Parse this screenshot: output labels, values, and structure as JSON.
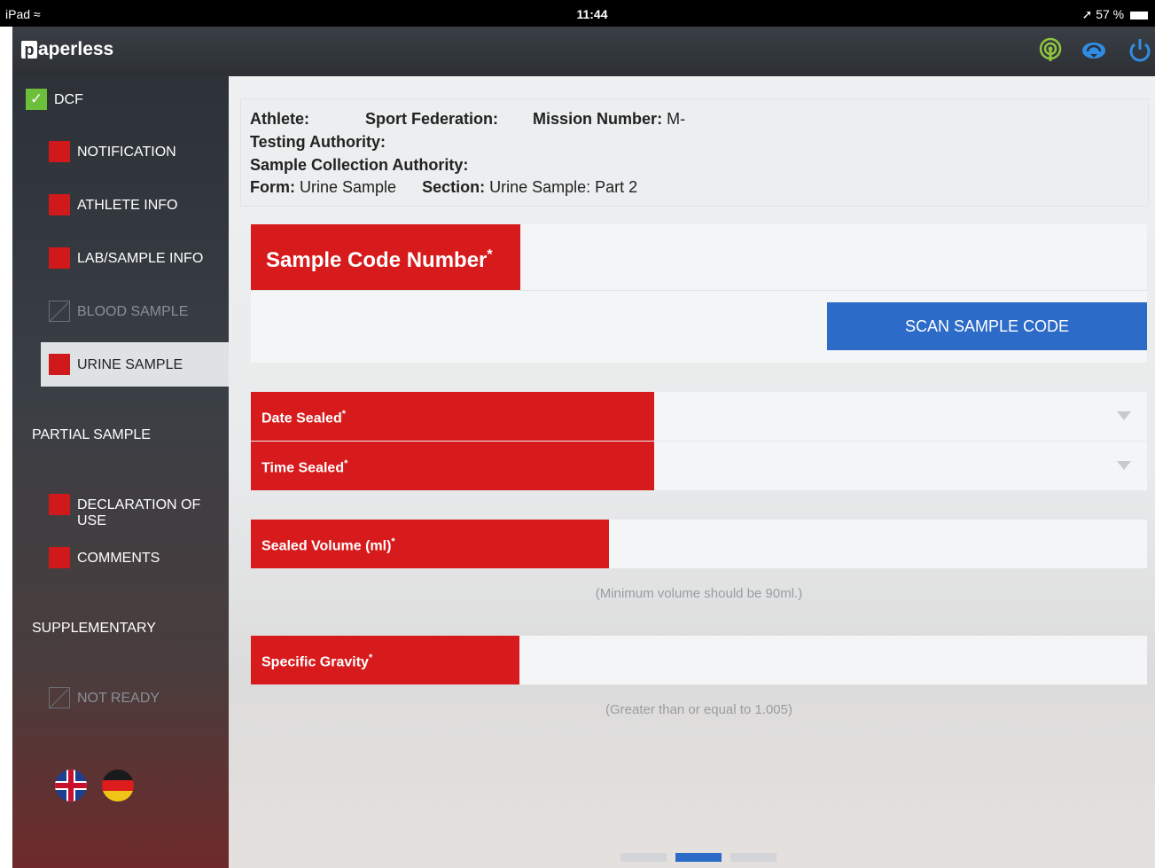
{
  "status_bar": {
    "device": "iPad",
    "time": "11:44",
    "battery": "57 %"
  },
  "app": {
    "logo": "paperless"
  },
  "sidebar": {
    "dcf_label": "DCF",
    "items": [
      {
        "label": "NOTIFICATION",
        "state": "incomplete"
      },
      {
        "label": "ATHLETE INFO",
        "state": "incomplete"
      },
      {
        "label": "LAB/SAMPLE INFO",
        "state": "incomplete"
      },
      {
        "label": "BLOOD SAMPLE",
        "state": "disabled"
      },
      {
        "label": "URINE SAMPLE",
        "state": "active"
      }
    ],
    "partial_sample_heading": "PARTIAL SAMPLE",
    "partial_items": [
      {
        "label": "DECLARATION OF USE",
        "state": "incomplete"
      },
      {
        "label": "COMMENTS",
        "state": "incomplete"
      }
    ],
    "supplementary_heading": "SUPPLEMENTARY",
    "supplementary_items": [
      {
        "label": "NOT READY",
        "state": "disabled"
      }
    ]
  },
  "info": {
    "athlete_label": "Athlete:",
    "sport_federation_label": "Sport Federation:",
    "mission_number_label": "Mission Number:",
    "mission_number_value": "M-",
    "testing_authority_label": "Testing Authority:",
    "sample_collection_authority_label": "Sample Collection Authority:",
    "form_label": "Form:",
    "form_value": "Urine Sample",
    "section_label": "Section:",
    "section_value": "Urine Sample: Part 2"
  },
  "form": {
    "sample_code_label": "Sample Code Number",
    "scan_button": "SCAN SAMPLE CODE",
    "date_sealed_label": "Date Sealed",
    "time_sealed_label": "Time Sealed",
    "sealed_volume_label": "Sealed Volume (ml)",
    "sealed_volume_hint": "(Minimum volume should be 90ml.)",
    "specific_gravity_label": "Specific Gravity",
    "specific_gravity_hint": "(Greater than or equal to 1.005)",
    "required_marker": "*"
  },
  "pager": {
    "pages": 3,
    "current": 2
  },
  "colors": {
    "required_red": "#d71a1c",
    "button_blue": "#2d6bc8",
    "check_green": "#6cbf3a"
  }
}
